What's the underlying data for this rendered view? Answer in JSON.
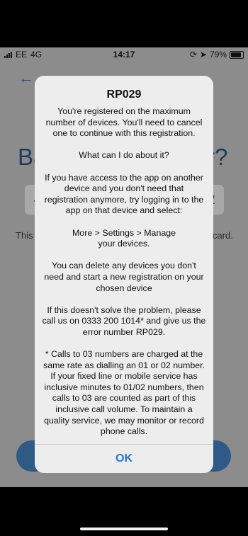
{
  "status_bar": {
    "carrier": "EE",
    "network": "4G",
    "time": "14:17",
    "battery": "79%",
    "battery_level": 0.79
  },
  "background": {
    "title_left": "Ba",
    "title_right": "r?",
    "chip_left": "4",
    "chip_right": "2",
    "text_left": "This",
    "text_right": "card."
  },
  "alert": {
    "title": "RP029",
    "message": "You're registered on the maximum number of devices. You'll need to cancel one to continue with this registration.\n\nWhat can I do about it?\n\nIf you have access to the app on another device and you don't need that registration anymore, try logging in to the app on that device and select:\n\nMore > Settings > Manage\nyour devices.\n\nYou can delete any devices you don't need and start a new registration on your chosen device\n\nIf this doesn't solve the problem, please call us on 0333 200 1014* and give us the error number RP029.\n\n* Calls to 03 numbers are charged at the same rate as dialling an 01 or 02 number. If your fixed line or mobile service has inclusive minutes to 01/02 numbers, then calls to 03 are counted as part of this inclusive call volume. To maintain a quality service, we may monitor or record phone calls.",
    "ok_label": "OK"
  },
  "colors": {
    "accent": "#2b73d6",
    "brand": "#2e5a85"
  },
  "icons": {
    "back": "back-arrow-icon",
    "signal": "signal-icon",
    "location": "location-icon",
    "lock": "rotation-lock-icon",
    "battery": "battery-icon"
  }
}
